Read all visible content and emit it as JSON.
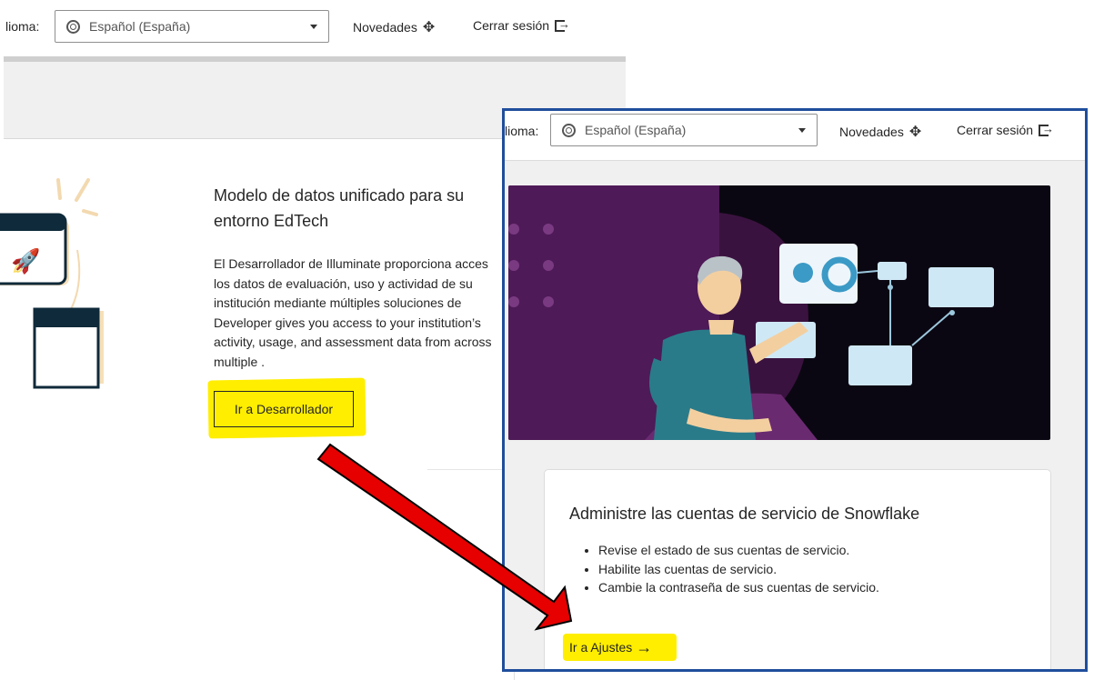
{
  "background_page": {
    "language_label": "lioma:",
    "language_select_value": "Español (España)",
    "news_label": "Novedades",
    "logout_label": "Cerrar sesión",
    "developer_card": {
      "title_line1": "Modelo de datos unificado para su",
      "title_line2": "entorno EdTech",
      "body_lines": [
        "El Desarrollador de Illuminate proporciona acces",
        "los datos de evaluación, uso y actividad de su",
        "institución mediante múltiples soluciones de",
        "Developer gives you access to your institution’s",
        "activity, usage, and assessment data from across",
        "multiple ."
      ],
      "button_label": "Ir a Desarrollador"
    }
  },
  "foreground_page": {
    "language_label": "lioma:",
    "language_select_value": "Español (España)",
    "news_label": "Novedades",
    "logout_label": "Cerrar sesión",
    "snowflake_card": {
      "title": "Administre las cuentas de servicio de Snowflake",
      "bullets": [
        "Revise el estado de sus cuentas de servicio.",
        "Habilite las cuentas de servicio.",
        "Cambie la contraseña de sus cuentas de servicio."
      ],
      "link_label": "Ir a Ajustes"
    }
  },
  "colors": {
    "highlight": "#ffee00",
    "arrow": "#e60000",
    "frame_border": "#1f4e9c",
    "hero_background": "#0b0712",
    "hero_purple": "#5a1e63"
  }
}
